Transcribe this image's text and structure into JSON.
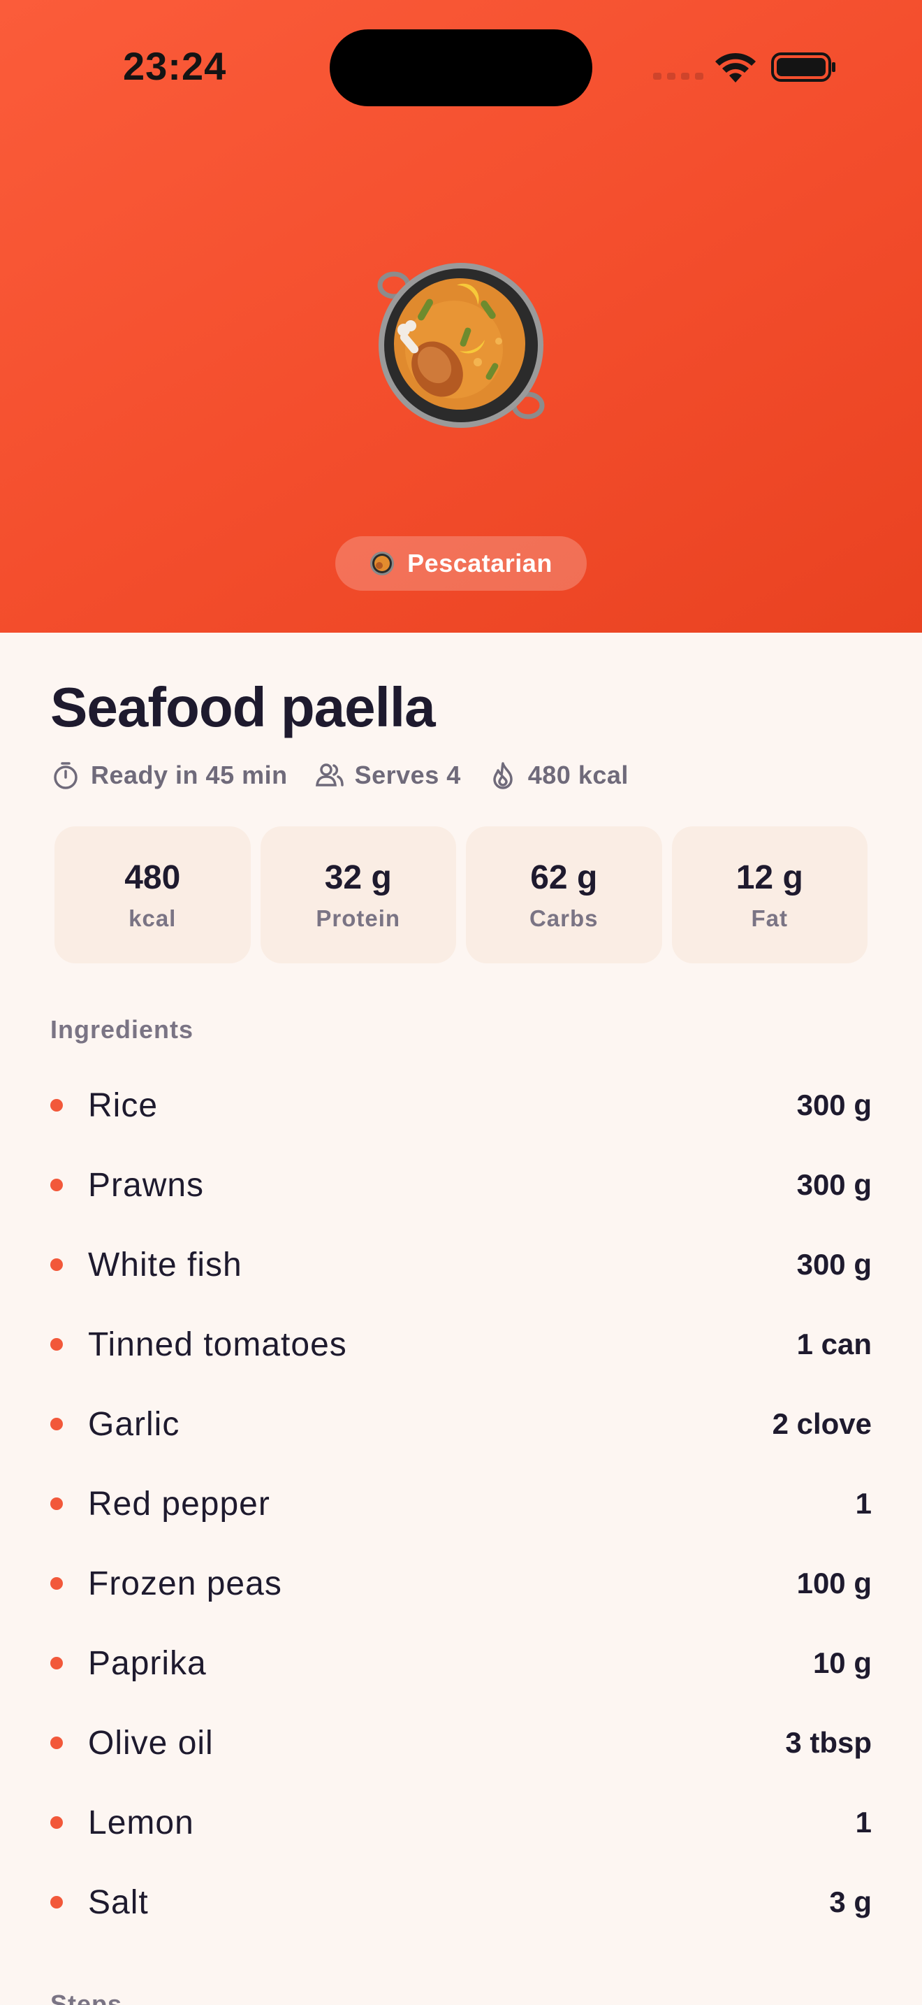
{
  "status": {
    "time": "23:24"
  },
  "hero": {
    "diet_label": "Pescatarian",
    "colors": {
      "gradient_start": "#FB5C3A",
      "gradient_end": "#E94221"
    }
  },
  "recipe": {
    "title": "Seafood paella",
    "meta": {
      "ready": "Ready in 45 min",
      "serves": "Serves 4",
      "calories": "480 kcal"
    },
    "macros": [
      {
        "value": "480",
        "label": "kcal"
      },
      {
        "value": "32 g",
        "label": "Protein"
      },
      {
        "value": "62 g",
        "label": "Carbs"
      },
      {
        "value": "12 g",
        "label": "Fat"
      }
    ]
  },
  "sections": {
    "ingredients": "Ingredients",
    "steps": "Steps"
  },
  "ingredients": [
    {
      "name": "Rice",
      "qty": "300 g"
    },
    {
      "name": "Prawns",
      "qty": "300 g"
    },
    {
      "name": "White fish",
      "qty": "300 g"
    },
    {
      "name": "Tinned tomatoes",
      "qty": "1 can"
    },
    {
      "name": "Garlic",
      "qty": "2 clove"
    },
    {
      "name": "Red pepper",
      "qty": "1"
    },
    {
      "name": "Frozen peas",
      "qty": "100 g"
    },
    {
      "name": "Paprika",
      "qty": "10 g"
    },
    {
      "name": "Olive oil",
      "qty": "3 tbsp"
    },
    {
      "name": "Lemon",
      "qty": "1"
    },
    {
      "name": "Salt",
      "qty": "3 g"
    }
  ],
  "icons": {
    "dish": "paella-pan-icon",
    "ready": "stopwatch-icon",
    "serves": "people-icon",
    "calories": "flame-icon"
  }
}
